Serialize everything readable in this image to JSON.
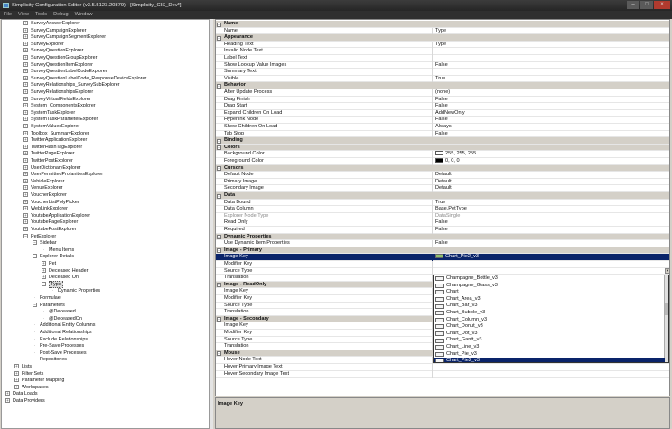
{
  "window": {
    "title": "Simplicity Configuration Editor (v3.5.5123.20879) - [Simplicity_CIS_Dev*]"
  },
  "menu": [
    "File",
    "View",
    "Tools",
    "Debug",
    "Window"
  ],
  "tree": [
    {
      "label": "SurveyAnswerExplorer",
      "indent": 2,
      "marker": "+"
    },
    {
      "label": "SurveyCampaignExplorer",
      "indent": 2,
      "marker": "+"
    },
    {
      "label": "SurveyCampaignSegmentExplorer",
      "indent": 2,
      "marker": "+"
    },
    {
      "label": "SurveyExplorer",
      "indent": 2,
      "marker": "+"
    },
    {
      "label": "SurveyQuestionExplorer",
      "indent": 2,
      "marker": "+"
    },
    {
      "label": "SurveyQuestionGroupExplorer",
      "indent": 2,
      "marker": "+"
    },
    {
      "label": "SurveyQuestionItemExplorer",
      "indent": 2,
      "marker": "+"
    },
    {
      "label": "SurveyQuestionLabelCodeExplorer",
      "indent": 2,
      "marker": "+"
    },
    {
      "label": "SurveyQuestionLabelCode_ResponseDeviceExplorer",
      "indent": 2,
      "marker": "+"
    },
    {
      "label": "SurveyRelationships_SurveySubExplorer",
      "indent": 2,
      "marker": "+"
    },
    {
      "label": "SurveyRelationshipsExplorer",
      "indent": 2,
      "marker": "+"
    },
    {
      "label": "SurveyVirtualFieldsExplorer",
      "indent": 2,
      "marker": "+"
    },
    {
      "label": "System_ComponentsExplorer",
      "indent": 2,
      "marker": "+"
    },
    {
      "label": "SystemTaskExplorer",
      "indent": 2,
      "marker": "+"
    },
    {
      "label": "SystemTaskParameterExplorer",
      "indent": 2,
      "marker": "+"
    },
    {
      "label": "SystemValuesExplorer",
      "indent": 2,
      "marker": "+"
    },
    {
      "label": "Toolbox_SummaryExplorer",
      "indent": 2,
      "marker": "+"
    },
    {
      "label": "TwitterApplicationExplorer",
      "indent": 2,
      "marker": "+"
    },
    {
      "label": "TwitterHashTagExplorer",
      "indent": 2,
      "marker": "+"
    },
    {
      "label": "TwitterPageExplorer",
      "indent": 2,
      "marker": "+"
    },
    {
      "label": "TwitterPostExplorer",
      "indent": 2,
      "marker": "+"
    },
    {
      "label": "UserDictionaryExplorer",
      "indent": 2,
      "marker": "+"
    },
    {
      "label": "UserPermittedProfanitiesExplorer",
      "indent": 2,
      "marker": "+"
    },
    {
      "label": "VehicleExplorer",
      "indent": 2,
      "marker": "+"
    },
    {
      "label": "VenueExplorer",
      "indent": 2,
      "marker": "+"
    },
    {
      "label": "VoucherExplorer",
      "indent": 2,
      "marker": "+"
    },
    {
      "label": "VoucherListPolyPicker",
      "indent": 2,
      "marker": "+"
    },
    {
      "label": "WebLinkExplorer",
      "indent": 2,
      "marker": "+"
    },
    {
      "label": "YoutubeApplicationExplorer",
      "indent": 2,
      "marker": "+"
    },
    {
      "label": "YoutubePageExplorer",
      "indent": 2,
      "marker": "+"
    },
    {
      "label": "YoutubePostExplorer",
      "indent": 2,
      "marker": "+"
    },
    {
      "label": "PetExplorer",
      "indent": 2,
      "marker": "-"
    },
    {
      "label": "Sidebar",
      "indent": 3,
      "marker": "-"
    },
    {
      "label": "Menu Items",
      "indent": 4,
      "marker": "·"
    },
    {
      "label": "Explorer Details",
      "indent": 3,
      "marker": "-"
    },
    {
      "label": "Pet",
      "indent": 4,
      "marker": "+"
    },
    {
      "label": "Deceased Header",
      "indent": 4,
      "marker": "+"
    },
    {
      "label": "Deceased On",
      "indent": 4,
      "marker": "+"
    },
    {
      "label": "Type",
      "indent": 4,
      "marker": "-",
      "selected": true
    },
    {
      "label": "Dynamic Properties",
      "indent": 5,
      "marker": "·"
    },
    {
      "label": "Formulae",
      "indent": 3,
      "marker": "·"
    },
    {
      "label": "Parameters",
      "indent": 3,
      "marker": "-"
    },
    {
      "label": "@Deceased",
      "indent": 4,
      "marker": "·"
    },
    {
      "label": "@DeceasedOn",
      "indent": 4,
      "marker": "·"
    },
    {
      "label": "Additional Entity Columns",
      "indent": 3,
      "marker": "·"
    },
    {
      "label": "Additional Relationships",
      "indent": 3,
      "marker": "·"
    },
    {
      "label": "Exclude Relationships",
      "indent": 3,
      "marker": "·"
    },
    {
      "label": "Pre-Save Processes",
      "indent": 3,
      "marker": "·"
    },
    {
      "label": "Post-Save Processes",
      "indent": 3,
      "marker": "·"
    },
    {
      "label": "Repositories",
      "indent": 3,
      "marker": "·"
    },
    {
      "label": "Lists",
      "indent": 1,
      "marker": "+"
    },
    {
      "label": "Filter Sets",
      "indent": 1,
      "marker": "+"
    },
    {
      "label": "Parameter Mapping",
      "indent": 1,
      "marker": "+"
    },
    {
      "label": "Workspaces",
      "indent": 1,
      "marker": "+"
    },
    {
      "label": "Data Loads",
      "indent": 0,
      "marker": "+"
    },
    {
      "label": "Data Providers",
      "indent": 0,
      "marker": "+"
    }
  ],
  "properties": [
    {
      "type": "cat",
      "name": "Name"
    },
    {
      "name": "Name",
      "value": "Type"
    },
    {
      "type": "cat",
      "name": "Appearance"
    },
    {
      "name": "Heading Text",
      "value": "Type"
    },
    {
      "name": "Invalid Node Text",
      "value": ""
    },
    {
      "name": "Label Text",
      "value": ""
    },
    {
      "name": "Show Lookup Value Images",
      "value": "False"
    },
    {
      "name": "Summary Text",
      "value": ""
    },
    {
      "name": "Visible",
      "value": "True"
    },
    {
      "type": "cat",
      "name": "Behavior"
    },
    {
      "name": "After Update Process",
      "value": "(none)"
    },
    {
      "name": "Drag Finish",
      "value": "False"
    },
    {
      "name": "Drag Start",
      "value": "False"
    },
    {
      "name": "Expand Children On Load",
      "value": "AddNewOnly"
    },
    {
      "name": "Hyperlink Node",
      "value": "False"
    },
    {
      "name": "Show Children On Load",
      "value": "Always"
    },
    {
      "name": "Tab Stop",
      "value": "False"
    },
    {
      "type": "cat",
      "name": "Binding"
    },
    {
      "type": "cat",
      "name": "Colors"
    },
    {
      "name": "Background Color",
      "value": "255, 255, 255",
      "swatch": "#ffffff"
    },
    {
      "name": "Foreground Color",
      "value": "0, 0, 0",
      "swatch": "#000000"
    },
    {
      "type": "cat",
      "name": "Cursors"
    },
    {
      "name": "Default Node",
      "value": "Default"
    },
    {
      "name": "Primary Image",
      "value": "Default"
    },
    {
      "name": "Secondary Image",
      "value": "Default"
    },
    {
      "type": "cat",
      "name": "Data"
    },
    {
      "name": "Data Bound",
      "value": "True"
    },
    {
      "name": "Data Column",
      "value": "Base.PetType"
    },
    {
      "name": "Explorer Node Type",
      "value": "DataSingle",
      "disabled": true
    },
    {
      "name": "Read Only",
      "value": "False"
    },
    {
      "name": "Required",
      "value": "False"
    },
    {
      "type": "cat",
      "name": "Dynamic Properties"
    },
    {
      "name": "Use Dynamic Item Properties",
      "value": "False"
    },
    {
      "type": "cat",
      "name": "Image - Primary"
    },
    {
      "name": "Image Key",
      "value": "Chart_Pie2_v3",
      "selected": true,
      "thumb": true
    },
    {
      "name": "Modifier Key",
      "value": ""
    },
    {
      "name": "Source Type",
      "value": ""
    },
    {
      "name": "Translation",
      "value": ""
    },
    {
      "type": "cat",
      "name": "Image - ReadOnly"
    },
    {
      "name": "Image Key",
      "value": ""
    },
    {
      "name": "Modifier Key",
      "value": ""
    },
    {
      "name": "Source Type",
      "value": ""
    },
    {
      "name": "Translation",
      "value": ""
    },
    {
      "type": "cat",
      "name": "Image - Secondary"
    },
    {
      "name": "Image Key",
      "value": ""
    },
    {
      "name": "Modifier Key",
      "value": ""
    },
    {
      "name": "Source Type",
      "value": ""
    },
    {
      "name": "Translation",
      "value": ""
    },
    {
      "type": "cat",
      "name": "Mouse"
    },
    {
      "name": "Hover Node Text",
      "value": ""
    },
    {
      "name": "Hover Primary Image Text",
      "value": ""
    },
    {
      "name": "Hover Secondary Image Text",
      "value": ""
    }
  ],
  "dropdown": {
    "items": [
      "Champagne_Bottle_v3",
      "Champagne_Glass_v3",
      "Chart",
      "Chart_Area_v3",
      "Chart_Bar_v3",
      "Chart_Bubble_v3",
      "Chart_Column_v3",
      "Chart_Donut_v3",
      "Chart_Dot_v3",
      "Chart_Gantt_v3",
      "Chart_Line_v3",
      "Chart_Pie_v3",
      "Chart_Pie2_v3"
    ],
    "selected": "Chart_Pie2_v3"
  },
  "description": {
    "title": "Image Key"
  }
}
